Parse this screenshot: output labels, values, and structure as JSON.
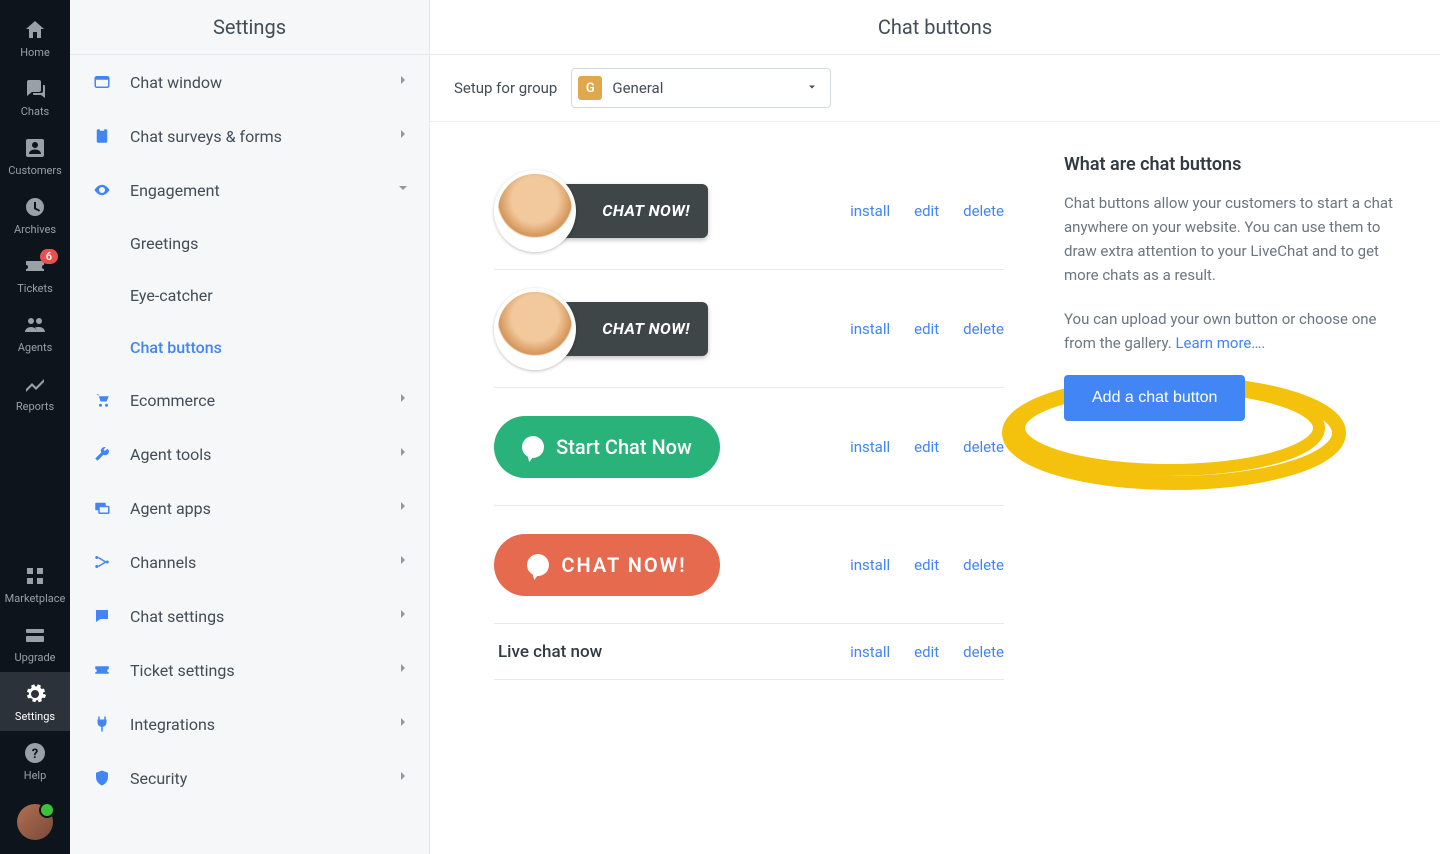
{
  "nav": {
    "home": "Home",
    "chats": "Chats",
    "customers": "Customers",
    "archives": "Archives",
    "tickets": "Tickets",
    "tickets_badge": "6",
    "agents": "Agents",
    "reports": "Reports",
    "marketplace": "Marketplace",
    "upgrade": "Upgrade",
    "settings": "Settings",
    "help": "Help"
  },
  "settings": {
    "title": "Settings",
    "items": {
      "chat_window": "Chat window",
      "surveys": "Chat surveys & forms",
      "engagement": "Engagement",
      "greetings": "Greetings",
      "eye_catcher": "Eye-catcher",
      "chat_buttons": "Chat buttons",
      "ecommerce": "Ecommerce",
      "agent_tools": "Agent tools",
      "agent_apps": "Agent apps",
      "channels": "Channels",
      "chat_settings": "Chat settings",
      "ticket_settings": "Ticket settings",
      "integrations": "Integrations",
      "security": "Security"
    }
  },
  "main": {
    "title": "Chat buttons",
    "setup_label": "Setup for group",
    "group_code": "G",
    "group_name": "General",
    "actions": {
      "install": "install",
      "edit": "edit",
      "delete": "delete"
    },
    "previews": {
      "chat_now_caps": "CHAT NOW!",
      "start_chat": "Start Chat Now",
      "live_chat": "Live chat now"
    }
  },
  "info": {
    "heading": "What are chat buttons",
    "p1": "Chat buttons allow your customers to start a chat anywhere on your website. You can use them to draw extra attention to your LiveChat and to get more chats as a result.",
    "p2_a": "You can upload your own button or choose one from the gallery. ",
    "learn_more": "Learn more….",
    "add_button": "Add a chat button"
  }
}
